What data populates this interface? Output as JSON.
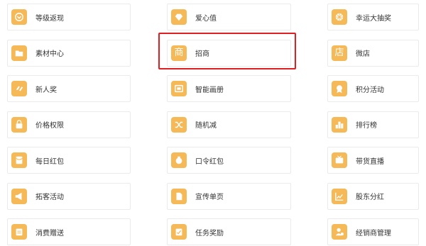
{
  "accent_color": "#f5b957",
  "highlight_color": "#e02020",
  "columns": [
    [
      {
        "label": "等级返现",
        "icon": "badge-icon"
      },
      {
        "label": "素材中心",
        "icon": "folder-icon"
      },
      {
        "label": "新人奖",
        "icon": "hands-icon"
      },
      {
        "label": "价格权限",
        "icon": "lock-bag-icon"
      },
      {
        "label": "每日红包",
        "icon": "red-packet-icon"
      },
      {
        "label": "拓客活动",
        "icon": "megaphone-icon"
      },
      {
        "label": "消费赠送",
        "icon": "clipboard-icon"
      }
    ],
    [
      {
        "label": "爱心值",
        "icon": "heart-diamond-icon"
      },
      {
        "label": "招商",
        "icon": "shang-icon",
        "glyph": "商"
      },
      {
        "label": "智能画册",
        "icon": "album-icon"
      },
      {
        "label": "随机减",
        "icon": "shuffle-icon"
      },
      {
        "label": "口令红包",
        "icon": "money-bag-icon"
      },
      {
        "label": "宣传单页",
        "icon": "flyer-icon"
      },
      {
        "label": "任务奖励",
        "icon": "task-clipboard-icon"
      }
    ],
    [
      {
        "label": "幸运大抽奖",
        "icon": "lottery-wheel-icon"
      },
      {
        "label": "微店",
        "icon": "dian-icon",
        "glyph": "店"
      },
      {
        "label": "积分活动",
        "icon": "medal-icon"
      },
      {
        "label": "排行榜",
        "icon": "ranking-icon"
      },
      {
        "label": "带货直播",
        "icon": "live-tv-icon"
      },
      {
        "label": "股东分红",
        "icon": "growth-chart-icon"
      },
      {
        "label": "经销商管理",
        "icon": "dealer-icon"
      }
    ]
  ]
}
